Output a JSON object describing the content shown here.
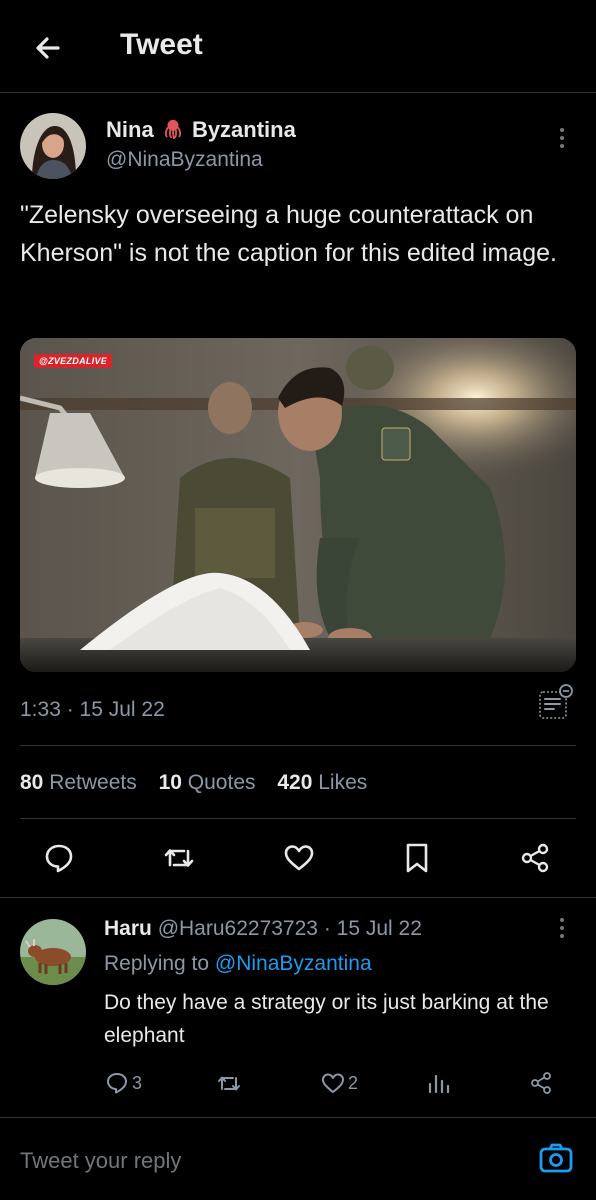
{
  "header": {
    "title": "Tweet",
    "back_icon": "arrow-left-icon"
  },
  "tweet": {
    "author_name_first": "Nina",
    "author_emoji": "🐙",
    "author_name_last": "Byzantina",
    "author_handle": "@NinaByzantina",
    "text": "\"Zelensky overseeing a huge counterattack on Kherson\" is not the caption for this edited image.",
    "media_watermark": "@ZVEZDALIVE",
    "timestamp": "1:33 · 15 Jul 22",
    "stats": {
      "retweets_count": "80",
      "retweets_label": "Retweets",
      "quotes_count": "10",
      "quotes_label": "Quotes",
      "likes_count": "420",
      "likes_label": "Likes"
    }
  },
  "reply": {
    "name": "Haru",
    "handle": "@Haru62273723",
    "date": "· 15 Jul 22",
    "replying_label": "Replying to",
    "replying_to": "@NinaByzantina",
    "text": "Do they have a strategy or its just barking at the elephant",
    "reply_count": "3",
    "like_count": "2"
  },
  "composer": {
    "placeholder": "Tweet your reply"
  },
  "colors": {
    "background": "#000000",
    "accent": "#1d9bf0",
    "muted": "#8b98a5",
    "divider": "#2f3336"
  }
}
